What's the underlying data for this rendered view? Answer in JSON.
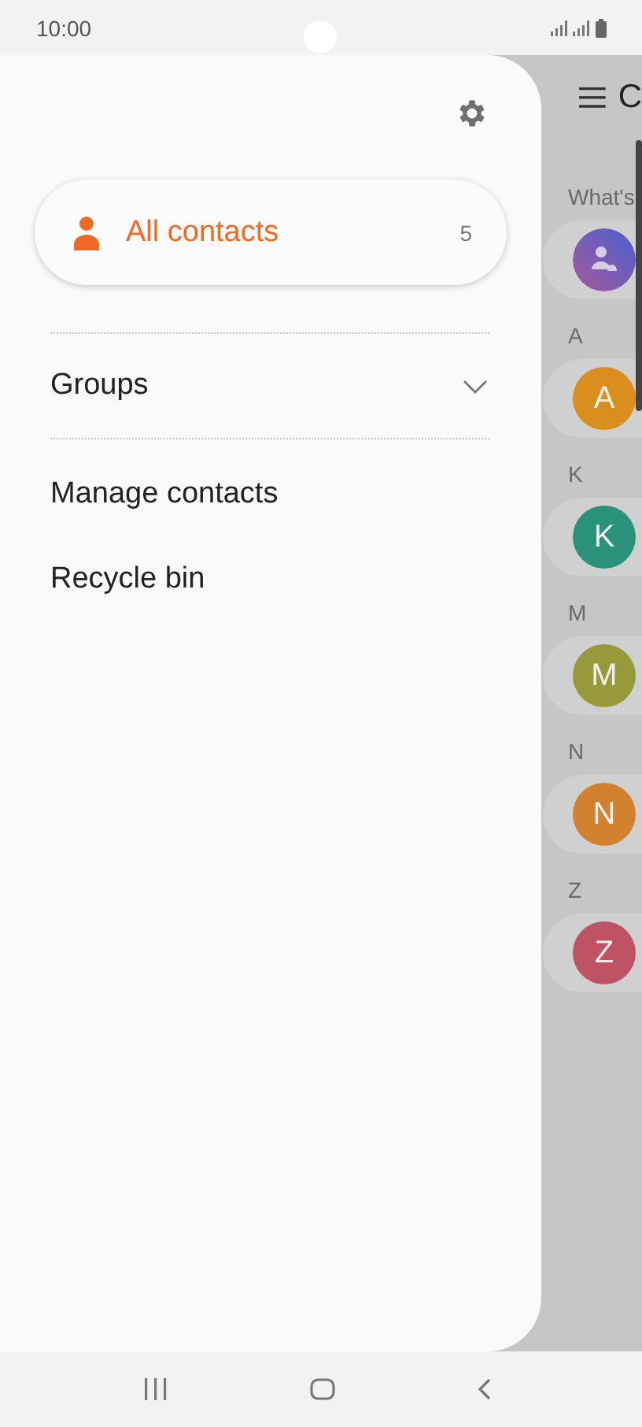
{
  "status_bar": {
    "time": "10:00"
  },
  "drawer": {
    "items": [
      {
        "kind": "primary",
        "label": "All contacts",
        "count": "5",
        "selected": true
      },
      {
        "kind": "group",
        "label": "Groups",
        "expanded": false
      },
      {
        "kind": "link",
        "label": "Manage contacts"
      },
      {
        "kind": "link",
        "label": "Recycle bin"
      }
    ]
  },
  "background": {
    "title": "C",
    "intro_header": "What's",
    "sections": [
      {
        "header": "A",
        "initial": "A",
        "color": "#d98e1e"
      },
      {
        "header": "K",
        "initial": "K",
        "color": "#2a917a"
      },
      {
        "header": "M",
        "initial": "M",
        "color": "#97993a"
      },
      {
        "header": "N",
        "initial": "N",
        "color": "#d2822e"
      },
      {
        "header": "Z",
        "initial": "Z",
        "color": "#bf5366"
      }
    ]
  }
}
